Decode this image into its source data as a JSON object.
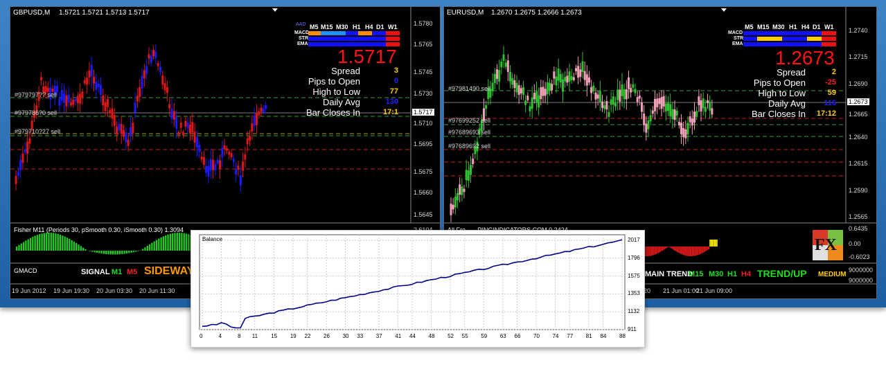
{
  "left_chart": {
    "symbol": "GBPUSD,M",
    "ohlc": "1.5721 1.5721 1.5713 1.5717",
    "price_big": "1.5717",
    "tf_headers": [
      "AAD",
      "M5",
      "M15",
      "M30",
      "H1",
      "H4",
      "D1",
      "W1"
    ],
    "rows": [
      "MACD",
      "STR",
      "EMA"
    ],
    "info": [
      {
        "label": "Spread",
        "value": "3",
        "color": "#ffcc00"
      },
      {
        "label": "Pips to Open",
        "value": "0",
        "color": "#2222ff"
      },
      {
        "label": "High to Low",
        "value": "77",
        "color": "#ffcc00"
      },
      {
        "label": "Daily Avg",
        "value": "130",
        "color": "#2222ff"
      },
      {
        "label": "Bar Closes In",
        "value": "17:1",
        "color": "#ffcc00"
      }
    ],
    "orders": [
      "#979797?? sell",
      "#979786?0 sell",
      "#979710?27 sell"
    ],
    "price_axis": [
      "1.5780",
      "1.5765",
      "1.5745",
      "1.5730",
      "1.5710",
      "1.5695",
      "1.5675",
      "1.5660",
      "1.5645"
    ],
    "current_price_tag": "1.5717",
    "fisher_label": "Fisher M11 (Periods 30, pSmooth 0.30, iSmooth 0.30) 1.3094",
    "fisher_axis": "2.6104",
    "gmacd": {
      "label": "GMACD",
      "signal": "SIGNAL",
      "m1": "M1",
      "m5": "M5",
      "state": "SIDEWAY"
    },
    "time_axis": [
      "19 Jun 2012",
      "19 Jun 19:30",
      "20 Jun 03:30",
      "20 Jun 11:30"
    ]
  },
  "right_chart": {
    "symbol": "EURUSD,M",
    "ohlc": "1.2670 1.2675 1.2666 1.2673",
    "price_big": "1.2673",
    "tf_headers": [
      "M5",
      "M15",
      "M30",
      "H1",
      "H4",
      "D1",
      "W1"
    ],
    "rows": [
      "MACD",
      "STR",
      "EMA"
    ],
    "info": [
      {
        "label": "Spread",
        "value": "2",
        "color": "#ffcc00"
      },
      {
        "label": "Pips to Open",
        "value": "-25",
        "color": "#ff2020"
      },
      {
        "label": "High to Low",
        "value": "59",
        "color": "#ffcc00"
      },
      {
        "label": "Daily Avg",
        "value": "116",
        "color": "#2222ff"
      },
      {
        "label": "Bar Closes In",
        "value": "17:12",
        "color": "#ffcc00"
      }
    ],
    "orders": [
      "#97981490 sell",
      "#97699252 sell",
      "#97689693 sell",
      "#97689692 sell"
    ],
    "price_axis": [
      "1.2740",
      "1.2715",
      "1.2690",
      "1.2665",
      "1.2640",
      "1.2615",
      "1.2590",
      "1.2565"
    ],
    "current_price_tag": "1.2673",
    "sub_label": "All Fre... ...PINGINDICATORS.COM 0.2424",
    "sub_axis": [
      "0.6435",
      "0.00",
      "-0.6023"
    ],
    "trend": {
      "main": "MAIN TREND",
      "m15": "M15",
      "m30": "M30",
      "h1": "H1",
      "h4": "H4",
      "state": "TREND/UP",
      "strength": "MEDIUM"
    },
    "trend_axis": [
      "9000000",
      "9000000"
    ],
    "time_axis": [
      "20",
      "21 Jun 01:00",
      "21 Jun 09:00"
    ],
    "logo_text": "FX"
  },
  "balance": {
    "title": "Balance",
    "y_axis": [
      "2017",
      "1796",
      "1575",
      "1353",
      "1132",
      "911"
    ],
    "x_axis": [
      "0",
      "4",
      "8",
      "11",
      "15",
      "19",
      "22",
      "26",
      "30",
      "33",
      "37",
      "41",
      "44",
      "48",
      "52",
      "55",
      "59",
      "63",
      "66",
      "70",
      "74",
      "77",
      "81",
      "84",
      "88"
    ]
  }
}
